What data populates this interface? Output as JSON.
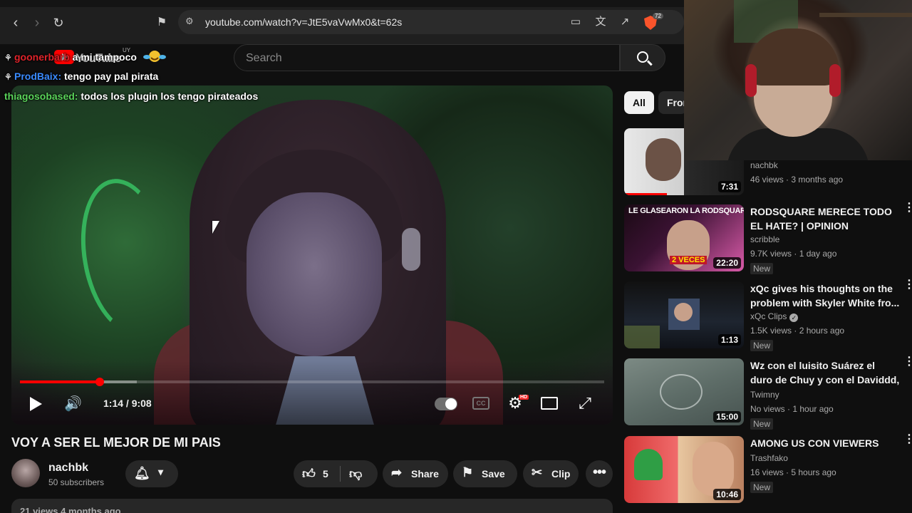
{
  "browser": {
    "url": "youtube.com/watch?v=JtE5vaVwMx0&t=62s",
    "brave_badge": "72"
  },
  "masthead": {
    "wordmark": "YouTube",
    "country": "UY",
    "search_placeholder": "Search"
  },
  "chat": [
    {
      "user": "goonerbarb",
      "user_color": "#e0232a",
      "message": "a mi tampoco"
    },
    {
      "user": "ProdBaix:",
      "user_color": "#3a8bff",
      "message": "tengo pay pal pirata"
    },
    {
      "user": "thiagosobased:",
      "user_color": "#5ad45a",
      "message": "todos los plugin los tengo pirateados"
    }
  ],
  "player": {
    "time": "1:14 / 9:08",
    "progress_played": 0.136,
    "progress_buffered": 0.2,
    "cc_label": "CC",
    "hd_label": "HD"
  },
  "video": {
    "title": "VOY A SER EL MEJOR DE MI PAIS",
    "channel": "nachbk",
    "subscribers": "50 subscribers",
    "likes": "5",
    "share_label": "Share",
    "save_label": "Save",
    "clip_label": "Clip",
    "views_line": "21 views  4 months ago"
  },
  "sidebar": {
    "chips": [
      "All",
      "From"
    ],
    "recommendations": [
      {
        "title": "",
        "channel": "nachbk",
        "meta": "46 views · 3 months ago",
        "duration": "7:31",
        "new": false,
        "verified": false
      },
      {
        "title": "RODSQUARE MERECE TODO EL HATE? | OPINION",
        "channel": "scribble",
        "meta": "9.7K views · 1 day ago",
        "duration": "22:20",
        "new": true,
        "verified": false
      },
      {
        "title": "xQc gives his thoughts on the problem with Skyler White fro...",
        "channel": "xQc Clips",
        "meta": "1.5K views · 2 hours ago",
        "duration": "1:13",
        "new": true,
        "verified": true
      },
      {
        "title": "Wz con el luisito Suárez el duro de Chuy y con el Daviddd, Cóm...",
        "channel": "Twimny",
        "meta": "No views · 1 hour ago",
        "duration": "15:00",
        "new": true,
        "verified": false
      },
      {
        "title": "AMONG US CON VIEWERS",
        "channel": "Trashfako",
        "meta": "16 views · 5 hours ago",
        "duration": "10:46",
        "new": true,
        "verified": false
      }
    ],
    "thumb_captions": {
      "rec1_overlay": "LE GLASEARON LA RODSQUARE",
      "rec1_sticker": "2 VECES"
    },
    "new_label": "New"
  },
  "colors": {
    "accent": "#ff0000",
    "background": "#0f0f0f",
    "pill": "#272727"
  }
}
